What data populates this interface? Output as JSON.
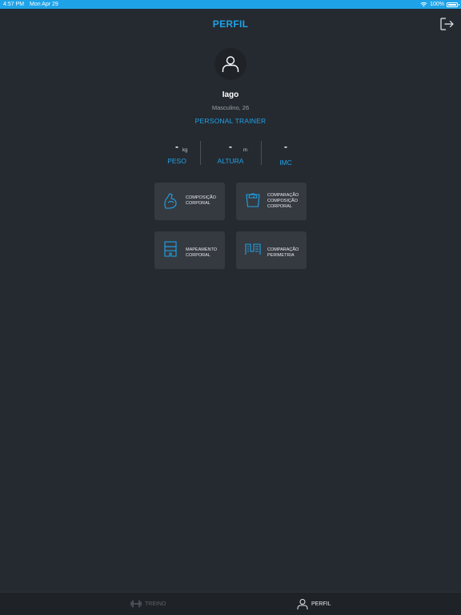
{
  "status_bar": {
    "time": "4:57 PM",
    "date": "Mon Apr 29",
    "battery": "100%"
  },
  "header": {
    "title": "PERFIL"
  },
  "profile": {
    "name": "Iago",
    "details": "Masculino, 26",
    "role": "PERSONAL TRAINER"
  },
  "metrics": [
    {
      "value": "-",
      "unit": "kg",
      "label": "PESO"
    },
    {
      "value": "-",
      "unit": "m",
      "label": "ALTURA"
    },
    {
      "value": "-",
      "unit": "",
      "label": "IMC"
    }
  ],
  "cards": [
    {
      "label": "COMPOSIÇÃO\nCORPORAL",
      "icon": "muscle-arm-icon"
    },
    {
      "label": "COMPARAÇÃO\nCOMPOSIÇÃO\nCORPORAL",
      "icon": "scale-icon"
    },
    {
      "label": "MAPEAMENTO\nCORPORAL",
      "icon": "body-map-icon"
    },
    {
      "label": "COMPARAÇÃO\nPERIMETRIA",
      "icon": "measuring-tape-icon"
    }
  ],
  "tabs": [
    {
      "label": "TREINO",
      "icon": "dumbbell-icon",
      "active": false
    },
    {
      "label": "PERFIL",
      "icon": "user-icon",
      "active": true
    }
  ],
  "colors": {
    "accent": "#1fa3e8",
    "background": "#252a31",
    "card": "#353a41",
    "tabbar": "#1f2328"
  }
}
